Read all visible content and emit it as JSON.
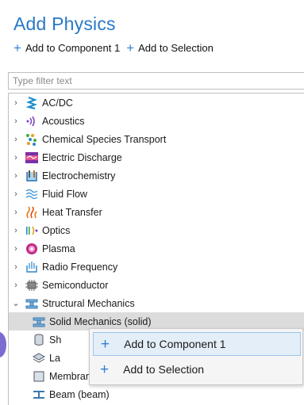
{
  "header": {
    "title": "Add Physics",
    "add_to_component": "Add to Component 1",
    "add_to_selection": "Add to Selection"
  },
  "filter": {
    "placeholder": "Type filter text",
    "value": ""
  },
  "tree": {
    "items": [
      {
        "label": "AC/DC",
        "icon": "acdc-icon",
        "expanded": false
      },
      {
        "label": "Acoustics",
        "icon": "acoustics-icon",
        "expanded": false
      },
      {
        "label": "Chemical Species Transport",
        "icon": "chemical-species-icon",
        "expanded": false
      },
      {
        "label": "Electric Discharge",
        "icon": "electric-discharge-icon",
        "expanded": false
      },
      {
        "label": "Electrochemistry",
        "icon": "electrochemistry-icon",
        "expanded": false
      },
      {
        "label": "Fluid Flow",
        "icon": "fluid-flow-icon",
        "expanded": false
      },
      {
        "label": "Heat Transfer",
        "icon": "heat-transfer-icon",
        "expanded": false
      },
      {
        "label": "Optics",
        "icon": "optics-icon",
        "expanded": false
      },
      {
        "label": "Plasma",
        "icon": "plasma-icon",
        "expanded": false
      },
      {
        "label": "Radio Frequency",
        "icon": "radio-frequency-icon",
        "expanded": false
      },
      {
        "label": "Semiconductor",
        "icon": "semiconductor-icon",
        "expanded": false
      },
      {
        "label": "Structural Mechanics",
        "icon": "structural-mechanics-icon",
        "expanded": true
      }
    ],
    "children": [
      {
        "label": "Solid Mechanics (solid)",
        "icon": "solid-mechanics-icon",
        "selected": true
      },
      {
        "label": "Sh",
        "icon": "shell-icon"
      },
      {
        "label": "La",
        "icon": "layered-icon"
      },
      {
        "label": "Membrane (mbrn)",
        "icon": "membrane-icon"
      },
      {
        "label": "Beam (beam)",
        "icon": "beam-icon"
      }
    ]
  },
  "context_menu": {
    "add_to_component": "Add to Component 1",
    "add_to_selection": "Add to Selection"
  },
  "colors": {
    "title": "#2878c8",
    "plus": "#2d7fd3",
    "selection": "#dcdcdc",
    "menu_highlight": "#e4eef8"
  }
}
